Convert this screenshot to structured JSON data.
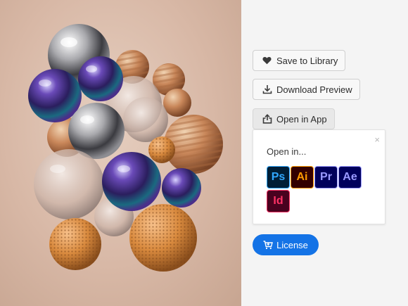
{
  "buttons": {
    "save": "Save to Library",
    "download": "Download Preview",
    "open": "Open in App",
    "license": "License"
  },
  "popover": {
    "title": "Open in...",
    "close": "×",
    "apps": [
      {
        "label": "Ps",
        "bg": "#001e36",
        "fg": "#31a8ff"
      },
      {
        "label": "Ai",
        "bg": "#330000",
        "fg": "#ff9a00"
      },
      {
        "label": "Pr",
        "bg": "#00005b",
        "fg": "#9999ff"
      },
      {
        "label": "Ae",
        "bg": "#00005b",
        "fg": "#9999ff"
      },
      {
        "label": "Id",
        "bg": "#49021f",
        "fg": "#ff3366"
      }
    ]
  },
  "colors": {
    "accent": "#1473e6"
  }
}
